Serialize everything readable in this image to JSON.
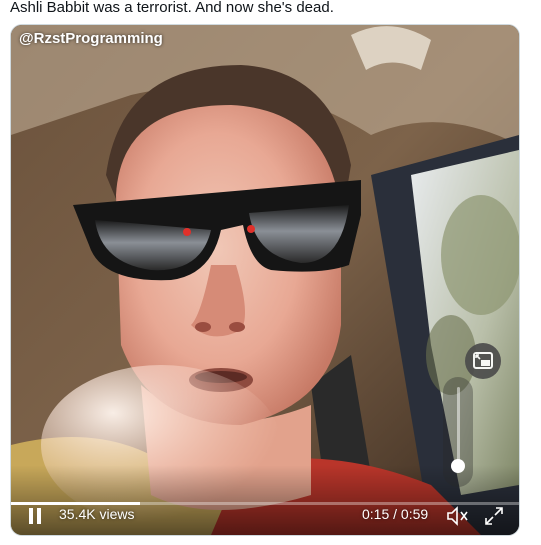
{
  "tweet": {
    "text": "Ashli Babbit was a terrorist. And now she's dead."
  },
  "video": {
    "watermark": "@RzstProgramming",
    "views": "35.4K views",
    "time": "0:15 / 0:59",
    "progress": 0.254,
    "volume": 0.07
  },
  "icons": {
    "play_pause": "pause-icon",
    "mute": "speaker-muted-icon",
    "fullscreen": "fullscreen-icon",
    "pip": "picture-in-picture-icon"
  },
  "colors": {
    "overlay_text": "#ffffff",
    "pip_bg": "#4a4a4a",
    "sunglasses": "#151515",
    "shirt": "#b9352a"
  }
}
